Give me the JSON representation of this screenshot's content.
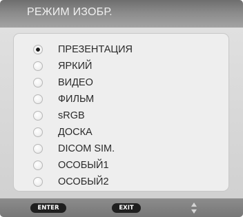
{
  "title": "РЕЖИМ ИЗОБР.",
  "options": [
    {
      "label": "ПРЕЗЕНТАЦИЯ",
      "selected": true
    },
    {
      "label": "ЯРКИЙ",
      "selected": false
    },
    {
      "label": "ВИДЕО",
      "selected": false
    },
    {
      "label": "ФИЛЬМ",
      "selected": false
    },
    {
      "label": "sRGB",
      "selected": false
    },
    {
      "label": "ДОСКА",
      "selected": false
    },
    {
      "label": "DICOM SIM.",
      "selected": false
    },
    {
      "label": "ОСОБЫЙ1",
      "selected": false
    },
    {
      "label": "ОСОБЫЙ2",
      "selected": false
    }
  ],
  "footer": {
    "enter_label": "ENTER",
    "exit_label": "EXIT",
    "navigate_icon": "up-down-arrows-icon"
  },
  "colors": {
    "title_bar": "#8a8a8a",
    "panel": "#eeeeee",
    "key_badge": "#1f1f1f",
    "selected_dot": "#1a1a1a"
  }
}
